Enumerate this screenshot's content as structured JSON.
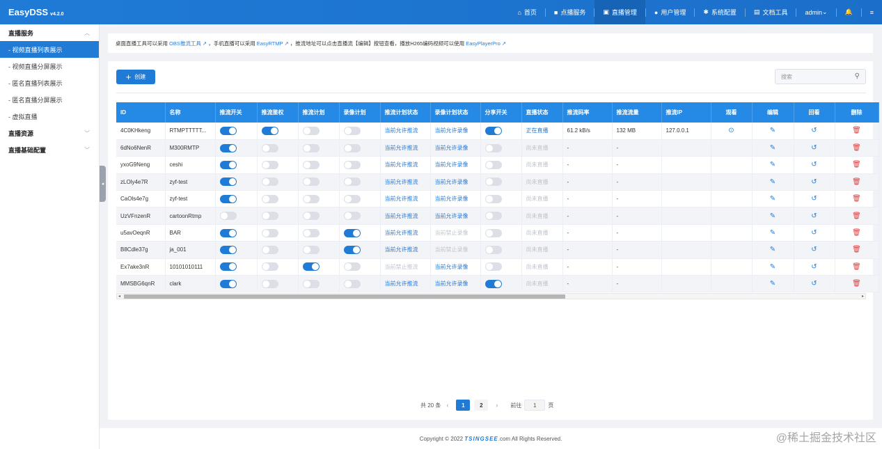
{
  "app": {
    "name": "EasyDSS",
    "version": "v4.2.0"
  },
  "nav": [
    {
      "icon": "home-icon",
      "glyph": "⌂",
      "label": "首页",
      "active": false
    },
    {
      "icon": "video-icon",
      "glyph": "■",
      "label": "点播服务",
      "active": false
    },
    {
      "icon": "live-icon",
      "glyph": "▣",
      "label": "直播管理",
      "active": true
    },
    {
      "icon": "user-icon",
      "glyph": "●",
      "label": "用户管理",
      "active": false
    },
    {
      "icon": "gear-icon",
      "glyph": "✱",
      "label": "系统配置",
      "active": false
    },
    {
      "icon": "doc-icon",
      "glyph": "▤",
      "label": "文档工具",
      "active": false
    }
  ],
  "user": {
    "name": "admin"
  },
  "sidebar": {
    "group1": "直播服务",
    "items": [
      "- 视频直播列表展示",
      "- 视频直播分屏展示",
      "- 匿名直播列表展示",
      "- 匿名直播分屏展示",
      "- 虚拟直播"
    ],
    "group2": "直播资源",
    "group3": "直播基础配置"
  },
  "notice": {
    "t1": "桌面直播工具可以采用",
    "l1": "OBS推流工具 ↗",
    "t2": "，手机直播可以采用",
    "l2": "EasyRTMP ↗",
    "t3": "，推流地址可以点击直播流【编辑】按钮查看，播放H265编码视频可以使用",
    "l3": "EasyPlayerPro ↗"
  },
  "toolbar": {
    "create": "创建",
    "search_placeholder": "搜索"
  },
  "columns": [
    "ID",
    "名称",
    "推流开关",
    "推流鉴权",
    "推流计划",
    "录像计划",
    "推流计划状态",
    "录像计划状态",
    "分享开关",
    "直播状态",
    "推流码率",
    "推流流量",
    "推流IP",
    "观看",
    "编辑",
    "回看",
    "删除"
  ],
  "rows": [
    {
      "id": "4C0KHkeng",
      "name": "RTMPTTTTT...",
      "push": true,
      "auth": true,
      "pushPlan": false,
      "recPlan": false,
      "pushState": "当前允许推流",
      "pushStateOn": true,
      "recState": "当前允许录像",
      "recStateOn": true,
      "share": true,
      "live": "正在直播",
      "liveOn": true,
      "rate": "61.2 kB/s",
      "flow": "132 MB",
      "ip": "127.0.0.1",
      "watch": true
    },
    {
      "id": "6dNo6NenR",
      "name": "M300RMTP",
      "push": true,
      "auth": false,
      "pushPlan": false,
      "recPlan": false,
      "pushState": "当前允许推流",
      "pushStateOn": true,
      "recState": "当前允许录像",
      "recStateOn": true,
      "share": false,
      "live": "尚未直播",
      "liveOn": false,
      "rate": "-",
      "flow": "-",
      "ip": "",
      "watch": false
    },
    {
      "id": "yxoG9Neng",
      "name": "ceshi",
      "push": true,
      "auth": false,
      "pushPlan": false,
      "recPlan": false,
      "pushState": "当前允许推流",
      "pushStateOn": true,
      "recState": "当前允许录像",
      "recStateOn": true,
      "share": false,
      "live": "尚未直播",
      "liveOn": false,
      "rate": "-",
      "flow": "-",
      "ip": "",
      "watch": false
    },
    {
      "id": "zLOly4e7R",
      "name": "zyf-test",
      "push": true,
      "auth": false,
      "pushPlan": false,
      "recPlan": false,
      "pushState": "当前允许推流",
      "pushStateOn": true,
      "recState": "当前允许录像",
      "recStateOn": true,
      "share": false,
      "live": "尚未直播",
      "liveOn": false,
      "rate": "-",
      "flow": "-",
      "ip": "",
      "watch": false
    },
    {
      "id": "CaOls4e7g",
      "name": "zyf-test",
      "push": true,
      "auth": false,
      "pushPlan": false,
      "recPlan": false,
      "pushState": "当前允许推流",
      "pushStateOn": true,
      "recState": "当前允许录像",
      "recStateOn": true,
      "share": false,
      "live": "尚未直播",
      "liveOn": false,
      "rate": "-",
      "flow": "-",
      "ip": "",
      "watch": false
    },
    {
      "id": "UzVFnzenR",
      "name": "cartoonRtmp",
      "push": false,
      "auth": false,
      "pushPlan": false,
      "recPlan": false,
      "pushState": "当前允许推流",
      "pushStateOn": true,
      "recState": "当前允许录像",
      "recStateOn": true,
      "share": false,
      "live": "尚未直播",
      "liveOn": false,
      "rate": "-",
      "flow": "-",
      "ip": "",
      "watch": false
    },
    {
      "id": "u5avOeqnR",
      "name": "BAR",
      "push": true,
      "auth": false,
      "pushPlan": false,
      "recPlan": true,
      "pushState": "当前允许推流",
      "pushStateOn": true,
      "recState": "当前禁止录像",
      "recStateOn": false,
      "share": false,
      "live": "尚未直播",
      "liveOn": false,
      "rate": "-",
      "flow": "-",
      "ip": "",
      "watch": false
    },
    {
      "id": "B8Cdle37g",
      "name": "ja_001",
      "push": true,
      "auth": false,
      "pushPlan": false,
      "recPlan": true,
      "pushState": "当前允许推流",
      "pushStateOn": true,
      "recState": "当前禁止录像",
      "recStateOn": false,
      "share": false,
      "live": "尚未直播",
      "liveOn": false,
      "rate": "-",
      "flow": "-",
      "ip": "",
      "watch": false
    },
    {
      "id": "Ex7ake3nR",
      "name": "10101010111",
      "push": true,
      "auth": false,
      "pushPlan": true,
      "recPlan": false,
      "pushState": "当前禁止推流",
      "pushStateOn": false,
      "recState": "当前允许录像",
      "recStateOn": true,
      "share": false,
      "live": "尚未直播",
      "liveOn": false,
      "rate": "-",
      "flow": "-",
      "ip": "",
      "watch": false
    },
    {
      "id": "MMSBG6qnR",
      "name": "clark",
      "push": true,
      "auth": false,
      "pushPlan": false,
      "recPlan": false,
      "pushState": "当前允许推流",
      "pushStateOn": true,
      "recState": "当前允许录像",
      "recStateOn": true,
      "share": true,
      "live": "尚未直播",
      "liveOn": false,
      "rate": "-",
      "flow": "-",
      "ip": "",
      "watch": false
    }
  ],
  "pagination": {
    "total": "共 20 条",
    "pages": [
      "1",
      "2"
    ],
    "current": "1",
    "goto": "前往",
    "goto_value": "1",
    "page_unit": "页"
  },
  "footer": {
    "pre": "Copyright © 2022",
    "brand": "TSINGSEE",
    "post": ".com All Rights Reserved."
  },
  "credit": "@稀土掘金技术社区",
  "colors": {
    "primary": "#1f7bd6",
    "header": "#2589e6",
    "danger": "#e03b3b"
  }
}
